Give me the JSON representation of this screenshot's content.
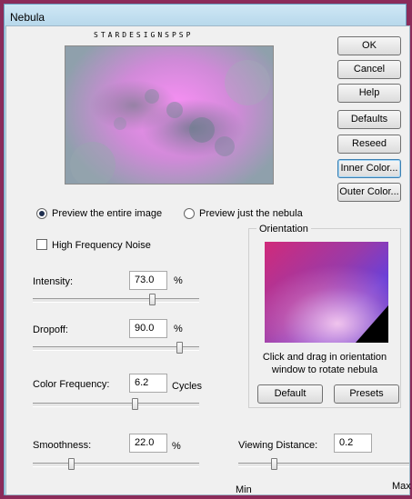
{
  "window": {
    "title": "Nebula"
  },
  "preview": {
    "caption": "STARDESIGNSPSP"
  },
  "buttons": {
    "ok": "OK",
    "cancel": "Cancel",
    "help": "Help",
    "defaults": "Defaults",
    "reseed": "Reseed",
    "inner_color": "Inner Color...",
    "outer_color": "Outer Color..."
  },
  "preview_mode": {
    "entire": "Preview the entire image",
    "nebula": "Preview just the nebula",
    "selected": "entire"
  },
  "high_frequency_noise": {
    "label": "High Frequency Noise",
    "checked": false
  },
  "controls": {
    "intensity": {
      "label": "Intensity:",
      "value": "73.0",
      "unit": "%",
      "level": 0.73
    },
    "dropoff": {
      "label": "Dropoff:",
      "value": "90.0",
      "unit": "%",
      "level": 0.9
    },
    "color_frequency": {
      "label": "Color Frequency:",
      "value": "6.2",
      "unit": "Cycles",
      "level": 0.62
    },
    "smoothness": {
      "label": "Smoothness:",
      "value": "22.0",
      "unit": "%",
      "level": 0.22
    },
    "viewing_distance": {
      "label": "Viewing Distance:",
      "value": "0.2",
      "min_label": "Min",
      "max_label": "Max",
      "level": 0.2
    }
  },
  "orientation": {
    "title": "Orientation",
    "instructions_line1": "Click and drag in orientation",
    "instructions_line2": "window to rotate nebula",
    "default_button": "Default",
    "presets_button": "Presets"
  },
  "colors": {
    "frame": "#8b2b5a",
    "nebula_pink": "#f28ef0",
    "nebula_gray": "#8fa0ac"
  }
}
